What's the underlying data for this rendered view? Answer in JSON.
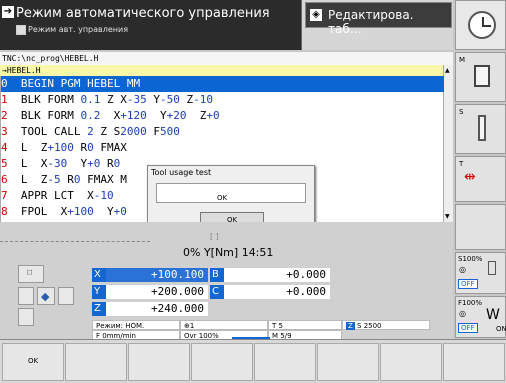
{
  "header": {
    "mode_title": "Режим автоматического управления",
    "mode_sub": "Режим авт. управления",
    "edit_mode": "Редактирова. таб…"
  },
  "program": {
    "path": "TNC:\\nc_prog\\HEBEL.H",
    "file": "→HEBEL.H",
    "lines": [
      {
        "n": "0",
        "t": "BEGIN PGM HEBEL MM"
      },
      {
        "n": "1",
        "t": "BLK FORM 0.1 Z X-35 Y-50 Z-10"
      },
      {
        "n": "2",
        "t": "BLK FORM 0.2  X+120  Y+20  Z+0"
      },
      {
        "n": "3",
        "t": "TOOL CALL 2 Z S2000 F500"
      },
      {
        "n": "4",
        "t": "L  Z+100 R0 FMAX"
      },
      {
        "n": "5",
        "t": "L  X-30  Y+0 R0"
      },
      {
        "n": "6",
        "t": "L  Z-5 R0 FMAX M"
      },
      {
        "n": "7",
        "t": "APPR LCT  X-10"
      },
      {
        "n": "8",
        "t": "FPOL  X+100  Y+0"
      }
    ]
  },
  "dialog": {
    "title": "Tool usage test",
    "inner_ok": "OK",
    "ok": "OK"
  },
  "status": {
    "text": "0% Y[Nm] 14:51",
    "partial": "[    ]"
  },
  "axes": {
    "x_label": "X",
    "x_value": "+100.100",
    "b_label": "B",
    "b_value": "+0.000",
    "y_label": "Y",
    "y_value": "+200.000",
    "c_label": "C",
    "c_value": "+0.000",
    "z_label": "Z",
    "z_value": "+240.000"
  },
  "info": {
    "mode": "Режим: НОМ.",
    "tool_sym": "1",
    "tool": "T 5",
    "spindle": "S 2500",
    "feed": "F 0mm/min",
    "ovr": "Ovr 100%",
    "m": "M 5/9"
  },
  "sidebar": {
    "m": "M",
    "s": "S",
    "t": "T",
    "s100": "S100%",
    "off1": "OFF",
    "f100": "F100%",
    "off2": "OFF",
    "on": "ON"
  },
  "softkeys": [
    "OK",
    "",
    "",
    "",
    "",
    "",
    "",
    "",
    ""
  ]
}
